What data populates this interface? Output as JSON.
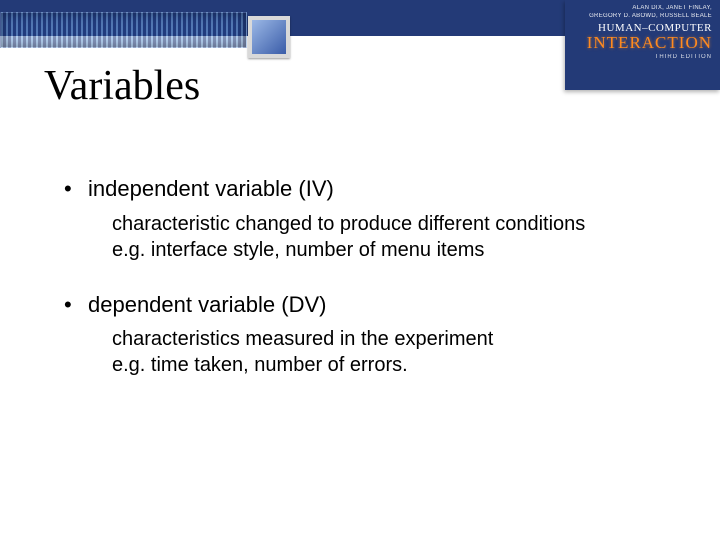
{
  "book": {
    "authors_line1": "ALAN DIX, JANET FINLAY,",
    "authors_line2": "GREGORY D. ABOWD, RUSSELL BEALE",
    "title_top": "HUMAN–COMPUTER",
    "title_bottom": "INTERACTION",
    "edition": "THIRD EDITION"
  },
  "slide": {
    "title": "Variables",
    "bullets": [
      {
        "heading": "independent variable (IV)",
        "detail": "characteristic changed to produce different conditions\ne.g. interface style, number of menu items"
      },
      {
        "heading": "dependent variable (DV)",
        "detail": "characteristics measured in the experiment\ne.g. time taken, number of errors."
      }
    ]
  }
}
